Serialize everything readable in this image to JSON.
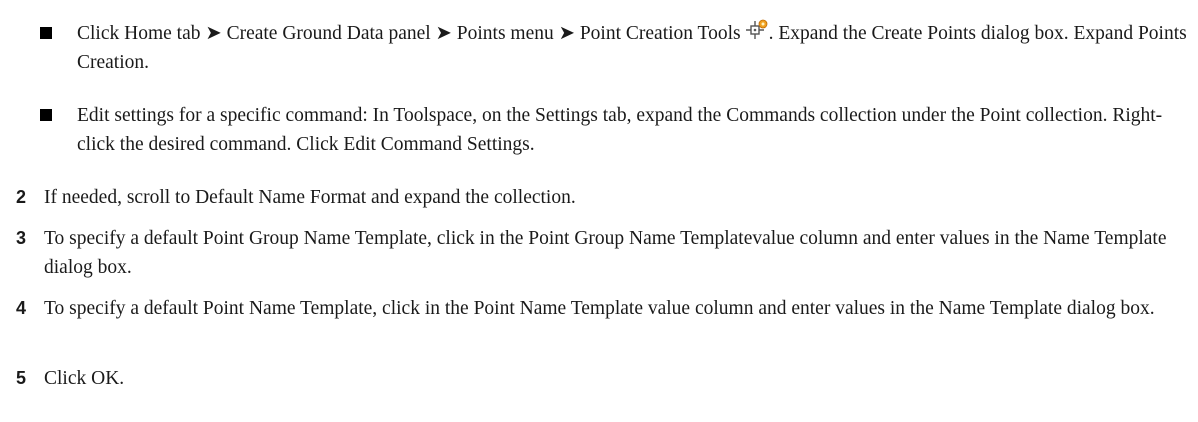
{
  "bullets": [
    {
      "before_icon": "Click Home tab ➤ Create Ground Data panel ➤ Points menu ➤ Point Creation Tools",
      "icon": "point-creation-tools-icon",
      "after_icon": ". Expand the Create Points dialog box. Expand Points Creation."
    },
    {
      "text": "Edit settings for a specific command: In Toolspace, on the Settings tab, expand the Commands collection under the Point collection. Right-click the desired command. Click Edit Command Settings."
    }
  ],
  "steps": [
    {
      "number": "2",
      "text": "If needed, scroll to Default Name Format and expand the collection."
    },
    {
      "number": "3",
      "text": "To specify a default Point Group Name Template, click in the Point Group Name Templatevalue column and enter values in the Name Template dialog box."
    },
    {
      "number": "4",
      "text": "To specify a default Point Name Template, click in the Point Name Template value column and enter values in the Name Template dialog box."
    },
    {
      "number": "5",
      "text": "Click OK."
    }
  ],
  "colors": {
    "text": "#1a1a1a",
    "icon_accent": "#f0a020"
  }
}
